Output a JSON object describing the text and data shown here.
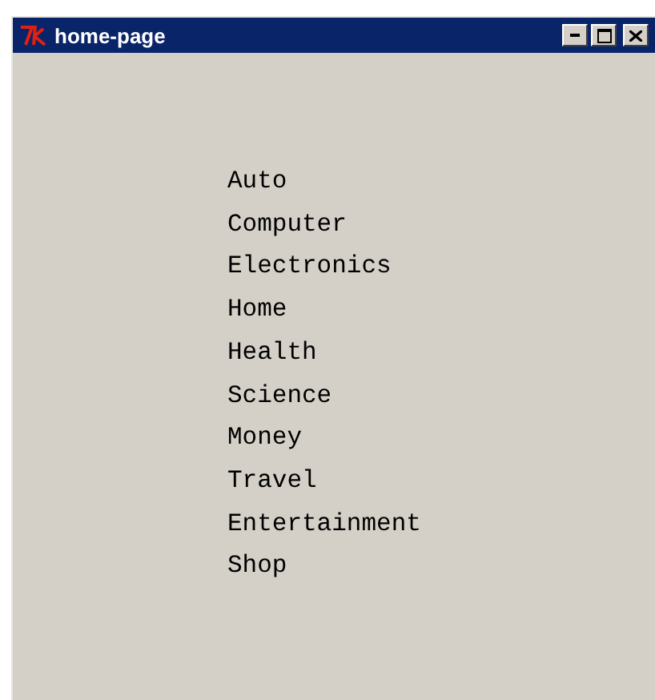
{
  "window": {
    "title": "home-page"
  },
  "menu_items": [
    {
      "label": "Auto"
    },
    {
      "label": "Computer"
    },
    {
      "label": "Electronics"
    },
    {
      "label": "Home"
    },
    {
      "label": "Health"
    },
    {
      "label": "Science"
    },
    {
      "label": "Money"
    },
    {
      "label": "Travel"
    },
    {
      "label": "Entertainment"
    },
    {
      "label": "Shop"
    }
  ]
}
